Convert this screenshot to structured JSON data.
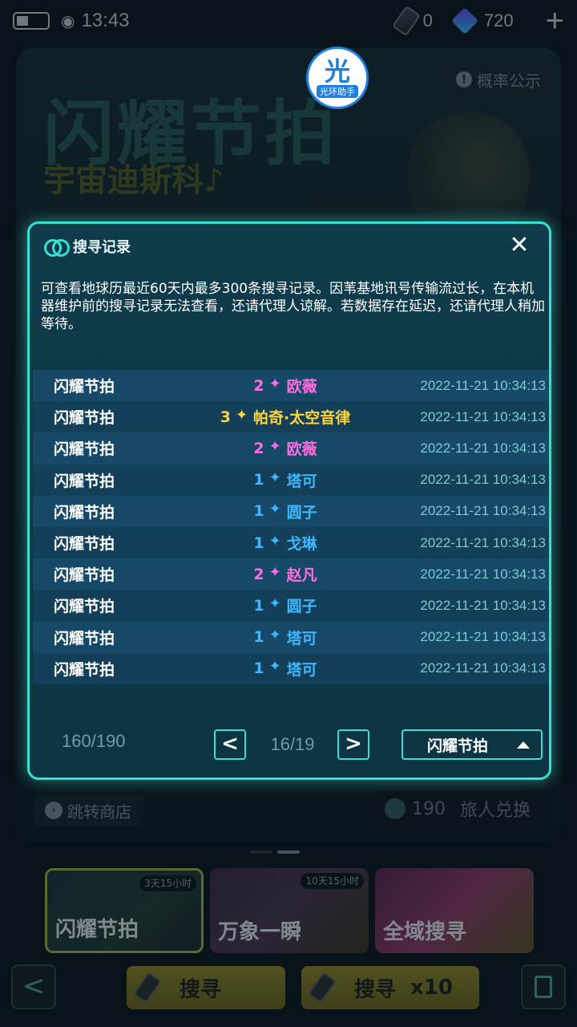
{
  "status": {
    "time": "13:43",
    "tickets": "0",
    "crystals": "720",
    "plus": "+"
  },
  "banner": {
    "title": "闪耀节拍",
    "subtitle": "宇宙迪斯科♪",
    "prob_label": "概率公示",
    "shop_label": "跳转商店",
    "exchange_count": "190",
    "exchange_label": "旅人兑换"
  },
  "watermark": {
    "big": "光",
    "small": "光环助手"
  },
  "modal": {
    "title": "搜寻记录",
    "close": "✕",
    "notice": "可查看地球历最近60天内最多300条搜寻记录。因苇基地讯号传输流过长，在本机器维护前的搜寻记录无法查看，还请代理人谅解。若数据存在延迟，还请代理人稍加等待。",
    "records": [
      {
        "pool": "闪耀节拍",
        "rank": "2",
        "name": "欧薇",
        "time": "2022-11-21 10:34:13",
        "q": "q2"
      },
      {
        "pool": "闪耀节拍",
        "rank": "3",
        "name": "帕奇·太空音律",
        "time": "2022-11-21 10:34:13",
        "q": "q3"
      },
      {
        "pool": "闪耀节拍",
        "rank": "2",
        "name": "欧薇",
        "time": "2022-11-21 10:34:13",
        "q": "q2"
      },
      {
        "pool": "闪耀节拍",
        "rank": "1",
        "name": "塔可",
        "time": "2022-11-21 10:34:13",
        "q": "q1"
      },
      {
        "pool": "闪耀节拍",
        "rank": "1",
        "name": "圆子",
        "time": "2022-11-21 10:34:13",
        "q": "q1"
      },
      {
        "pool": "闪耀节拍",
        "rank": "1",
        "name": "戈琳",
        "time": "2022-11-21 10:34:13",
        "q": "q1"
      },
      {
        "pool": "闪耀节拍",
        "rank": "2",
        "name": "赵凡",
        "time": "2022-11-21 10:34:13",
        "q": "q2"
      },
      {
        "pool": "闪耀节拍",
        "rank": "1",
        "name": "圆子",
        "time": "2022-11-21 10:34:13",
        "q": "q1"
      },
      {
        "pool": "闪耀节拍",
        "rank": "1",
        "name": "塔可",
        "time": "2022-11-21 10:34:13",
        "q": "q1"
      },
      {
        "pool": "闪耀节拍",
        "rank": "1",
        "name": "塔可",
        "time": "2022-11-21 10:34:13",
        "q": "q1"
      }
    ],
    "count": "160/190",
    "prev": "<",
    "page": "16/19",
    "next": ">",
    "pool_filter": "闪耀节拍"
  },
  "cards": [
    {
      "label": "闪耀节拍",
      "timer": "3天15小时"
    },
    {
      "label": "万象一瞬",
      "timer": "10天15小时"
    },
    {
      "label": "全域搜寻",
      "timer": ""
    }
  ],
  "bottom": {
    "back": "<",
    "pull1_label": "搜寻",
    "pull1_count": "1",
    "pull10_label": "搜寻",
    "pull10_mult": "x10",
    "pull10_count": "10"
  },
  "colors": {
    "accent": "#36e0d2",
    "rank1": "#3fb7ff",
    "rank2": "#ff6ee0",
    "rank3": "#ffd43b"
  }
}
